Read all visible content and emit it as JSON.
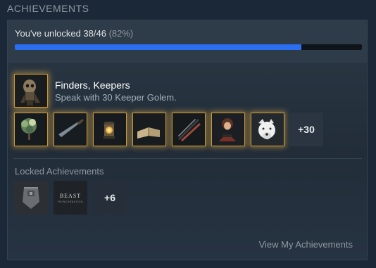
{
  "header": {
    "title": "ACHIEVEMENTS"
  },
  "progress": {
    "label": "You've unlocked 38/46",
    "percent_label": "(82%)",
    "fraction": 0.826
  },
  "featured": {
    "icon": "skull-golem-icon",
    "name": "Finders, Keepers",
    "description": "Speak with 30 Keeper Golem."
  },
  "unlocked_icons": [
    "tree-icon",
    "dagger-icon",
    "lantern-icon",
    "book-icon",
    "blades-icon",
    "character-portrait-icon",
    "wolf-icon"
  ],
  "unlocked_more": "+30",
  "locked": {
    "title": "Locked Achievements",
    "icons": [
      "armor-icon",
      "beast-logo-icon"
    ],
    "logo_text": "BEAST",
    "logo_subtext": "REINCARNATION",
    "more": "+6"
  },
  "footer": {
    "view_link": "View My Achievements"
  },
  "colors": {
    "background": "#1b2838",
    "progress_fill": "#2b6ef0",
    "gold_border": "#c89a3a"
  }
}
